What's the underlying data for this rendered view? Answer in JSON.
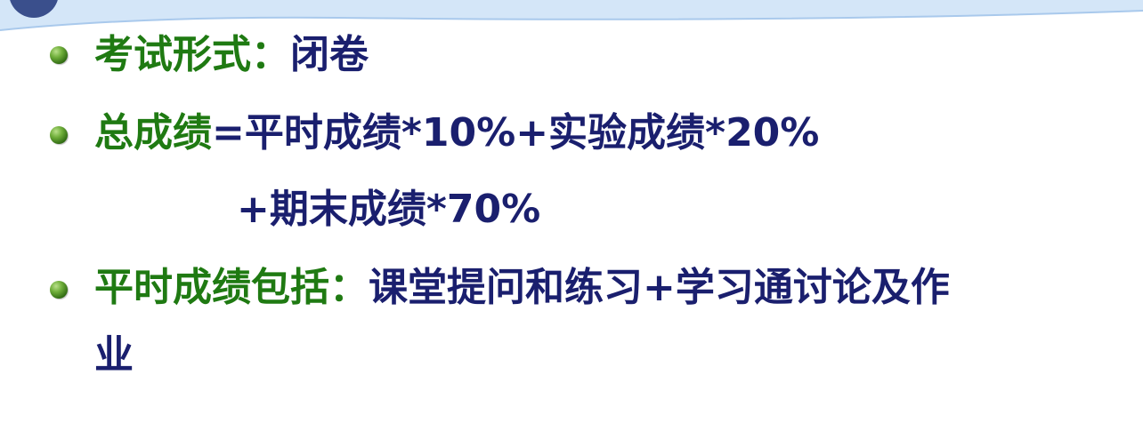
{
  "colors": {
    "label_green": "#1f7a12",
    "text_navy": "#1a1f6e",
    "band_blue": "#cfe3f7"
  },
  "items": [
    {
      "label": "考试形式：",
      "text": "闭卷"
    },
    {
      "label": "总成绩",
      "text": "=平时成绩*10%+实验成绩*20%",
      "continuation": "+期末成绩*70%"
    },
    {
      "label": "平时成绩包括：",
      "text": "课堂提问和练习+学习通讨论及作",
      "continuation": "业"
    }
  ]
}
